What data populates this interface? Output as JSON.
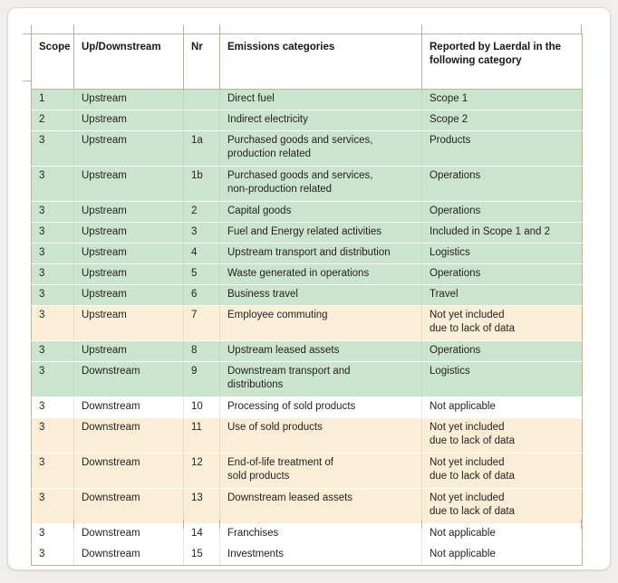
{
  "table": {
    "columns": [
      {
        "key": "scope",
        "label": "Scope"
      },
      {
        "key": "stream",
        "label": "Up/Downstream"
      },
      {
        "key": "nr",
        "label": "Nr"
      },
      {
        "key": "category",
        "label": "Emissions categories"
      },
      {
        "key": "reported",
        "label": "Reported by Laerdal in the following category"
      }
    ],
    "header": {
      "scope": "Scope",
      "stream": "Up/Downstream",
      "nr": "Nr",
      "category": "Emissions categories",
      "reported_line1": "Reported by Laerdal in the",
      "reported_line2": "following category"
    },
    "colors": {
      "green_fill": "#cbe4ce",
      "peach_fill": "#faeed7",
      "white_fill": "#ffffff",
      "grid_line": "#bdb29a",
      "text": "#231f1d",
      "card_background": "#ffffff",
      "page_background": "#f0efed"
    },
    "rows": [
      {
        "fill": "green",
        "lines": 1,
        "scope": "1",
        "stream": "Upstream",
        "nr": "",
        "category_line1": "Direct fuel",
        "category_line2": "",
        "reported_line1": "Scope 1",
        "reported_line2": ""
      },
      {
        "fill": "green",
        "lines": 1,
        "scope": "2",
        "stream": "Upstream",
        "nr": "",
        "category_line1": "Indirect electricity",
        "category_line2": "",
        "reported_line1": "Scope 2",
        "reported_line2": ""
      },
      {
        "fill": "green",
        "lines": 2,
        "scope": "3",
        "stream": "Upstream",
        "nr": "1a",
        "category_line1": "Purchased goods and services,",
        "category_line2": "production related",
        "reported_line1": "Products",
        "reported_line2": ""
      },
      {
        "fill": "green",
        "lines": 2,
        "scope": "3",
        "stream": "Upstream",
        "nr": "1b",
        "category_line1": "Purchased goods and services,",
        "category_line2": "non-production related",
        "reported_line1": "Operations",
        "reported_line2": ""
      },
      {
        "fill": "green",
        "lines": 1,
        "scope": "3",
        "stream": "Upstream",
        "nr": "2",
        "category_line1": "Capital goods",
        "category_line2": "",
        "reported_line1": "Operations",
        "reported_line2": ""
      },
      {
        "fill": "green",
        "lines": 1,
        "scope": "3",
        "stream": "Upstream",
        "nr": "3",
        "category_line1": "Fuel and Energy related activities",
        "category_line2": "",
        "reported_line1": "Included in Scope 1 and 2",
        "reported_line2": ""
      },
      {
        "fill": "green",
        "lines": 1,
        "scope": "3",
        "stream": "Upstream",
        "nr": "4",
        "category_line1": "Upstream transport and distribution",
        "category_line2": "",
        "reported_line1": "Logistics",
        "reported_line2": ""
      },
      {
        "fill": "green",
        "lines": 1,
        "scope": "3",
        "stream": "Upstream",
        "nr": "5",
        "category_line1": "Waste generated in operations",
        "category_line2": "",
        "reported_line1": "Operations",
        "reported_line2": ""
      },
      {
        "fill": "green",
        "lines": 1,
        "scope": "3",
        "stream": "Upstream",
        "nr": "6",
        "category_line1": "Business travel",
        "category_line2": "",
        "reported_line1": "Travel",
        "reported_line2": ""
      },
      {
        "fill": "peach",
        "lines": 2,
        "scope": "3",
        "stream": "Upstream",
        "nr": "7",
        "category_line1": "Employee commuting",
        "category_line2": "",
        "reported_line1": "Not yet included",
        "reported_line2": "due to lack of data"
      },
      {
        "fill": "green",
        "lines": 1,
        "scope": "3",
        "stream": "Upstream",
        "nr": "8",
        "category_line1": "Upstream leased assets",
        "category_line2": "",
        "reported_line1": "Operations",
        "reported_line2": ""
      },
      {
        "fill": "green",
        "lines": 2,
        "scope": "3",
        "stream": "Downstream",
        "nr": "9",
        "category_line1": "Downstream transport and",
        "category_line2": "distributions",
        "reported_line1": "Logistics",
        "reported_line2": ""
      },
      {
        "fill": "white",
        "lines": 1,
        "scope": "3",
        "stream": "Downstream",
        "nr": "10",
        "category_line1": "Processing of sold products",
        "category_line2": "",
        "reported_line1": "Not applicable",
        "reported_line2": ""
      },
      {
        "fill": "peach",
        "lines": 2,
        "scope": "3",
        "stream": "Downstream",
        "nr": "11",
        "category_line1": "Use of sold products",
        "category_line2": "",
        "reported_line1": "Not yet included",
        "reported_line2": "due to lack of data"
      },
      {
        "fill": "peach",
        "lines": 2,
        "scope": "3",
        "stream": "Downstream",
        "nr": "12",
        "category_line1": "End-of-life treatment of",
        "category_line2": "sold products",
        "reported_line1": "Not yet included",
        "reported_line2": "due to lack of data"
      },
      {
        "fill": "peach",
        "lines": 2,
        "scope": "3",
        "stream": "Downstream",
        "nr": "13",
        "category_line1": "Downstream leased assets",
        "category_line2": "",
        "reported_line1": "Not yet included",
        "reported_line2": "due to lack of data"
      },
      {
        "fill": "white",
        "lines": 1,
        "scope": "3",
        "stream": "Downstream",
        "nr": "14",
        "category_line1": "Franchises",
        "category_line2": "",
        "reported_line1": "Not applicable",
        "reported_line2": ""
      },
      {
        "fill": "white",
        "lines": 1,
        "scope": "3",
        "stream": "Downstream",
        "nr": "15",
        "category_line1": "Investments",
        "category_line2": "",
        "reported_line1": "Not applicable",
        "reported_line2": ""
      }
    ]
  }
}
